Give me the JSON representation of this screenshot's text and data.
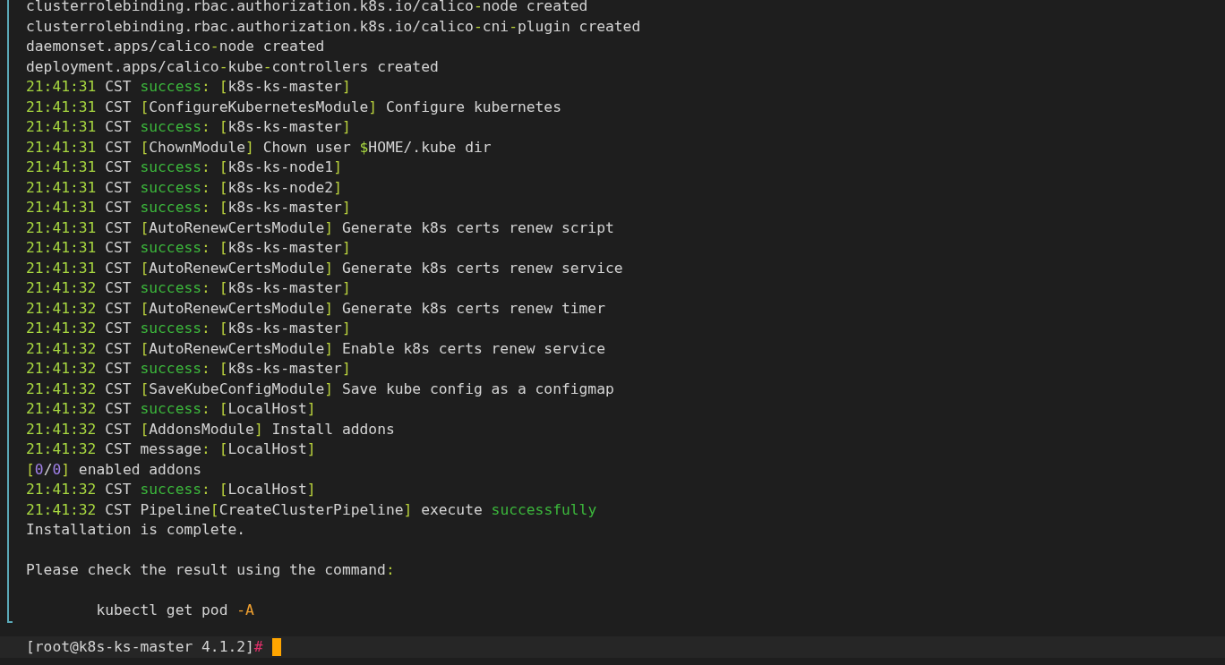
{
  "terminal": {
    "blocks": [
      {
        "lines": [
          [
            {
              "text": "clusterrolebinding.rbac.authorization.k8s.io/calico",
              "kind": "text"
            },
            {
              "text": "-",
              "kind": "punct"
            },
            {
              "text": "node created",
              "kind": "text"
            }
          ],
          [
            {
              "text": "clusterrolebinding.rbac.authorization.k8s.io/calico",
              "kind": "text"
            },
            {
              "text": "-",
              "kind": "punct"
            },
            {
              "text": "cni",
              "kind": "text"
            },
            {
              "text": "-",
              "kind": "punct"
            },
            {
              "text": "plugin created",
              "kind": "text"
            }
          ],
          [
            {
              "text": "daemonset.apps/calico",
              "kind": "text"
            },
            {
              "text": "-",
              "kind": "punct"
            },
            {
              "text": "node created",
              "kind": "text"
            }
          ],
          [
            {
              "text": "deployment.apps/calico",
              "kind": "text"
            },
            {
              "text": "-",
              "kind": "punct"
            },
            {
              "text": "kube",
              "kind": "text"
            },
            {
              "text": "-",
              "kind": "punct"
            },
            {
              "text": "controllers created",
              "kind": "text"
            }
          ],
          [
            {
              "text": "21:41:31",
              "kind": "time"
            },
            {
              "text": " CST ",
              "kind": "text"
            },
            {
              "text": "success",
              "kind": "ok"
            },
            {
              "text": ": [",
              "kind": "punct"
            },
            {
              "text": "k8s-ks-master",
              "kind": "text"
            },
            {
              "text": "]",
              "kind": "punct"
            }
          ],
          [
            {
              "text": "21:41:31",
              "kind": "time"
            },
            {
              "text": " CST ",
              "kind": "text"
            },
            {
              "text": "[",
              "kind": "punct"
            },
            {
              "text": "ConfigureKubernetesModule",
              "kind": "text"
            },
            {
              "text": "]",
              "kind": "punct"
            },
            {
              "text": " Configure kubernetes",
              "kind": "text"
            }
          ],
          [
            {
              "text": "21:41:31",
              "kind": "time"
            },
            {
              "text": " CST ",
              "kind": "text"
            },
            {
              "text": "success",
              "kind": "ok"
            },
            {
              "text": ": [",
              "kind": "punct"
            },
            {
              "text": "k8s-ks-master",
              "kind": "text"
            },
            {
              "text": "]",
              "kind": "punct"
            }
          ],
          [
            {
              "text": "21:41:31",
              "kind": "time"
            },
            {
              "text": " CST ",
              "kind": "text"
            },
            {
              "text": "[",
              "kind": "punct"
            },
            {
              "text": "ChownModule",
              "kind": "text"
            },
            {
              "text": "]",
              "kind": "punct"
            },
            {
              "text": " Chown user ",
              "kind": "text"
            },
            {
              "text": "$",
              "kind": "var"
            },
            {
              "text": "HOME/.kube dir",
              "kind": "text"
            }
          ],
          [
            {
              "text": "21:41:31",
              "kind": "time"
            },
            {
              "text": " CST ",
              "kind": "text"
            },
            {
              "text": "success",
              "kind": "ok"
            },
            {
              "text": ": [",
              "kind": "punct"
            },
            {
              "text": "k8s-ks-node1",
              "kind": "text"
            },
            {
              "text": "]",
              "kind": "punct"
            }
          ],
          [
            {
              "text": "21:41:31",
              "kind": "time"
            },
            {
              "text": " CST ",
              "kind": "text"
            },
            {
              "text": "success",
              "kind": "ok"
            },
            {
              "text": ": [",
              "kind": "punct"
            },
            {
              "text": "k8s-ks-node2",
              "kind": "text"
            },
            {
              "text": "]",
              "kind": "punct"
            }
          ],
          [
            {
              "text": "21:41:31",
              "kind": "time"
            },
            {
              "text": " CST ",
              "kind": "text"
            },
            {
              "text": "success",
              "kind": "ok"
            },
            {
              "text": ": [",
              "kind": "punct"
            },
            {
              "text": "k8s-ks-master",
              "kind": "text"
            },
            {
              "text": "]",
              "kind": "punct"
            }
          ],
          [
            {
              "text": "21:41:31",
              "kind": "time"
            },
            {
              "text": " CST ",
              "kind": "text"
            },
            {
              "text": "[",
              "kind": "punct"
            },
            {
              "text": "AutoRenewCertsModule",
              "kind": "text"
            },
            {
              "text": "]",
              "kind": "punct"
            },
            {
              "text": " Generate k8s certs renew script",
              "kind": "text"
            }
          ],
          [
            {
              "text": "21:41:31",
              "kind": "time"
            },
            {
              "text": " CST ",
              "kind": "text"
            },
            {
              "text": "success",
              "kind": "ok"
            },
            {
              "text": ": [",
              "kind": "punct"
            },
            {
              "text": "k8s-ks-master",
              "kind": "text"
            },
            {
              "text": "]",
              "kind": "punct"
            }
          ],
          [
            {
              "text": "21:41:31",
              "kind": "time"
            },
            {
              "text": " CST ",
              "kind": "text"
            },
            {
              "text": "[",
              "kind": "punct"
            },
            {
              "text": "AutoRenewCertsModule",
              "kind": "text"
            },
            {
              "text": "]",
              "kind": "punct"
            },
            {
              "text": " Generate k8s certs renew service",
              "kind": "text"
            }
          ],
          [
            {
              "text": "21:41:32",
              "kind": "time"
            },
            {
              "text": " CST ",
              "kind": "text"
            },
            {
              "text": "success",
              "kind": "ok"
            },
            {
              "text": ": [",
              "kind": "punct"
            },
            {
              "text": "k8s-ks-master",
              "kind": "text"
            },
            {
              "text": "]",
              "kind": "punct"
            }
          ],
          [
            {
              "text": "21:41:32",
              "kind": "time"
            },
            {
              "text": " CST ",
              "kind": "text"
            },
            {
              "text": "[",
              "kind": "punct"
            },
            {
              "text": "AutoRenewCertsModule",
              "kind": "text"
            },
            {
              "text": "]",
              "kind": "punct"
            },
            {
              "text": " Generate k8s certs renew timer",
              "kind": "text"
            }
          ],
          [
            {
              "text": "21:41:32",
              "kind": "time"
            },
            {
              "text": " CST ",
              "kind": "text"
            },
            {
              "text": "success",
              "kind": "ok"
            },
            {
              "text": ": [",
              "kind": "punct"
            },
            {
              "text": "k8s-ks-master",
              "kind": "text"
            },
            {
              "text": "]",
              "kind": "punct"
            }
          ],
          [
            {
              "text": "21:41:32",
              "kind": "time"
            },
            {
              "text": " CST ",
              "kind": "text"
            },
            {
              "text": "[",
              "kind": "punct"
            },
            {
              "text": "AutoRenewCertsModule",
              "kind": "text"
            },
            {
              "text": "]",
              "kind": "punct"
            },
            {
              "text": " Enable k8s certs renew service",
              "kind": "text"
            }
          ],
          [
            {
              "text": "21:41:32",
              "kind": "time"
            },
            {
              "text": " CST ",
              "kind": "text"
            },
            {
              "text": "success",
              "kind": "ok"
            },
            {
              "text": ": [",
              "kind": "punct"
            },
            {
              "text": "k8s-ks-master",
              "kind": "text"
            },
            {
              "text": "]",
              "kind": "punct"
            }
          ],
          [
            {
              "text": "21:41:32",
              "kind": "time"
            },
            {
              "text": " CST ",
              "kind": "text"
            },
            {
              "text": "[",
              "kind": "punct"
            },
            {
              "text": "SaveKubeConfigModule",
              "kind": "text"
            },
            {
              "text": "]",
              "kind": "punct"
            },
            {
              "text": " Save kube config as a configmap",
              "kind": "text"
            }
          ],
          [
            {
              "text": "21:41:32",
              "kind": "time"
            },
            {
              "text": " CST ",
              "kind": "text"
            },
            {
              "text": "success",
              "kind": "ok"
            },
            {
              "text": ": [",
              "kind": "punct"
            },
            {
              "text": "LocalHost",
              "kind": "text"
            },
            {
              "text": "]",
              "kind": "punct"
            }
          ],
          [
            {
              "text": "21:41:32",
              "kind": "time"
            },
            {
              "text": " CST ",
              "kind": "text"
            },
            {
              "text": "[",
              "kind": "punct"
            },
            {
              "text": "AddonsModule",
              "kind": "text"
            },
            {
              "text": "]",
              "kind": "punct"
            },
            {
              "text": " Install addons",
              "kind": "text"
            }
          ],
          [
            {
              "text": "21:41:32",
              "kind": "time"
            },
            {
              "text": " CST message",
              "kind": "text"
            },
            {
              "text": ": [",
              "kind": "punct"
            },
            {
              "text": "LocalHost",
              "kind": "text"
            },
            {
              "text": "]",
              "kind": "punct"
            }
          ],
          [
            {
              "text": "[",
              "kind": "punct"
            },
            {
              "text": "0",
              "kind": "num"
            },
            {
              "text": "/",
              "kind": "text"
            },
            {
              "text": "0",
              "kind": "num"
            },
            {
              "text": "]",
              "kind": "punct"
            },
            {
              "text": " enabled addons",
              "kind": "text"
            }
          ],
          [
            {
              "text": "21:41:32",
              "kind": "time"
            },
            {
              "text": " CST ",
              "kind": "text"
            },
            {
              "text": "success",
              "kind": "ok"
            },
            {
              "text": ": [",
              "kind": "punct"
            },
            {
              "text": "LocalHost",
              "kind": "text"
            },
            {
              "text": "]",
              "kind": "punct"
            }
          ],
          [
            {
              "text": "21:41:32",
              "kind": "time"
            },
            {
              "text": " CST Pipeline",
              "kind": "text"
            },
            {
              "text": "[",
              "kind": "punct"
            },
            {
              "text": "CreateClusterPipeline",
              "kind": "text"
            },
            {
              "text": "]",
              "kind": "punct"
            },
            {
              "text": " execute ",
              "kind": "text"
            },
            {
              "text": "successfully",
              "kind": "ok"
            }
          ],
          [
            {
              "text": "Installation is complete.",
              "kind": "text"
            }
          ]
        ]
      },
      {
        "lines": [
          [
            {
              "text": "Please check the result using the command",
              "kind": "text"
            },
            {
              "text": ":",
              "kind": "punct"
            }
          ]
        ]
      },
      {
        "lines": [
          [
            {
              "text": "        kubectl get pod ",
              "kind": "text"
            },
            {
              "text": "-A",
              "kind": "flag"
            }
          ]
        ]
      }
    ]
  },
  "prompt": {
    "text": "[root@k8s-ks-master 4.1.2]",
    "symbol": "#"
  }
}
